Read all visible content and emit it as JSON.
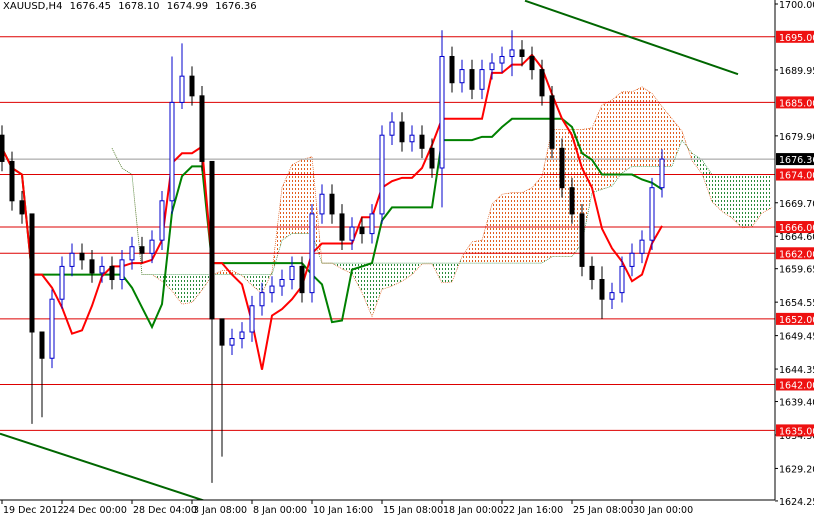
{
  "header": {
    "symbol": "XAUUSD,H4",
    "open": "1676.45",
    "high": "1678.10",
    "low": "1674.99",
    "close": "1676.36"
  },
  "chart_data": {
    "type": "candlestick",
    "title": "XAUUSD,H4",
    "ylim": [
      1622.5,
      1700.6
    ],
    "y_ticks": [
      "1700.00",
      "1689.95",
      "1679.90",
      "1669.70",
      "1664.60",
      "1659.65",
      "1654.55",
      "1649.45",
      "1644.35",
      "1639.40",
      "1634.30",
      "1629.20",
      "1624.25"
    ],
    "x_ticks": [
      "19 Dec 2012",
      "24 Dec 00:00",
      "28 Dec 04:00",
      "3 Jan 08:00",
      "8 Jan 00:00",
      "10 Jan 16:00",
      "15 Jan 08:00",
      "18 Jan 00:00",
      "22 Jan 16:00",
      "25 Jan 08:00",
      "30 Jan 00:00"
    ],
    "x_tick_bars": [
      0,
      6,
      13,
      19,
      25,
      31,
      38,
      44,
      50,
      57,
      63
    ],
    "closes": [
      1676,
      1670,
      1668,
      1650,
      1646,
      1655,
      1660,
      1662,
      1661,
      1659,
      1660,
      1658,
      1661,
      1663,
      1662,
      1664,
      1670,
      1685,
      1689,
      1686,
      1676,
      1652,
      1648,
      1649,
      1650,
      1654,
      1656,
      1657,
      1658,
      1660,
      1656,
      1668,
      1671,
      1668,
      1664,
      1666,
      1665,
      1668,
      1680,
      1682,
      1679,
      1680,
      1678,
      1675,
      1692,
      1688,
      1690,
      1687,
      1690,
      1691,
      1692,
      1693,
      1692,
      1690,
      1686,
      1678,
      1672,
      1668,
      1660,
      1658,
      1655,
      1656,
      1660,
      1662,
      1664,
      1672,
      1676.36
    ],
    "first_open": 1680,
    "wick_overrides": {
      "3": [
        1652,
        1636
      ],
      "4": [
        1650,
        1637
      ],
      "17": [
        1692,
        1668
      ],
      "18": [
        1694,
        1684
      ],
      "21": [
        1676,
        1627
      ],
      "22": [
        1652,
        1631
      ],
      "44": [
        1696,
        1669
      ],
      "51": [
        1696,
        1689
      ],
      "60": [
        1660,
        1652
      ]
    },
    "levels": [
      {
        "price": 1695.0,
        "label": "1695.00"
      },
      {
        "price": 1685.0,
        "label": "1685.00"
      },
      {
        "price": 1674.0,
        "label": "1674.00"
      },
      {
        "price": 1666.0,
        "label": "1666.00"
      },
      {
        "price": 1662.0,
        "label": "1662.00"
      },
      {
        "price": 1652.0,
        "label": "1652.00"
      },
      {
        "price": 1642.0,
        "label": "1642.00"
      },
      {
        "price": 1635.0,
        "label": "1635.00"
      }
    ],
    "current_price": {
      "price": 1676.36,
      "label": "1676.36"
    },
    "trendlines": [
      {
        "from": [
          -0.2,
          1634.5
        ],
        "to": [
          20.8,
          1624.0
        ]
      },
      {
        "from": [
          52.3,
          1700.5
        ],
        "to": [
          73.6,
          1689.3
        ]
      }
    ],
    "indicator": {
      "name": "Ichimoku",
      "tenkan": 5,
      "kijun": 13,
      "senkou_b": 26,
      "shift": 11
    },
    "colors": {
      "bull": "#0000cc",
      "bear": "#000000",
      "tenkan": "#ff0000",
      "kijun": "#008000",
      "cloud_up": "#e06020",
      "cloud_down": "#2a8a3a",
      "level": "#dd0000",
      "trend": "#006600"
    }
  }
}
